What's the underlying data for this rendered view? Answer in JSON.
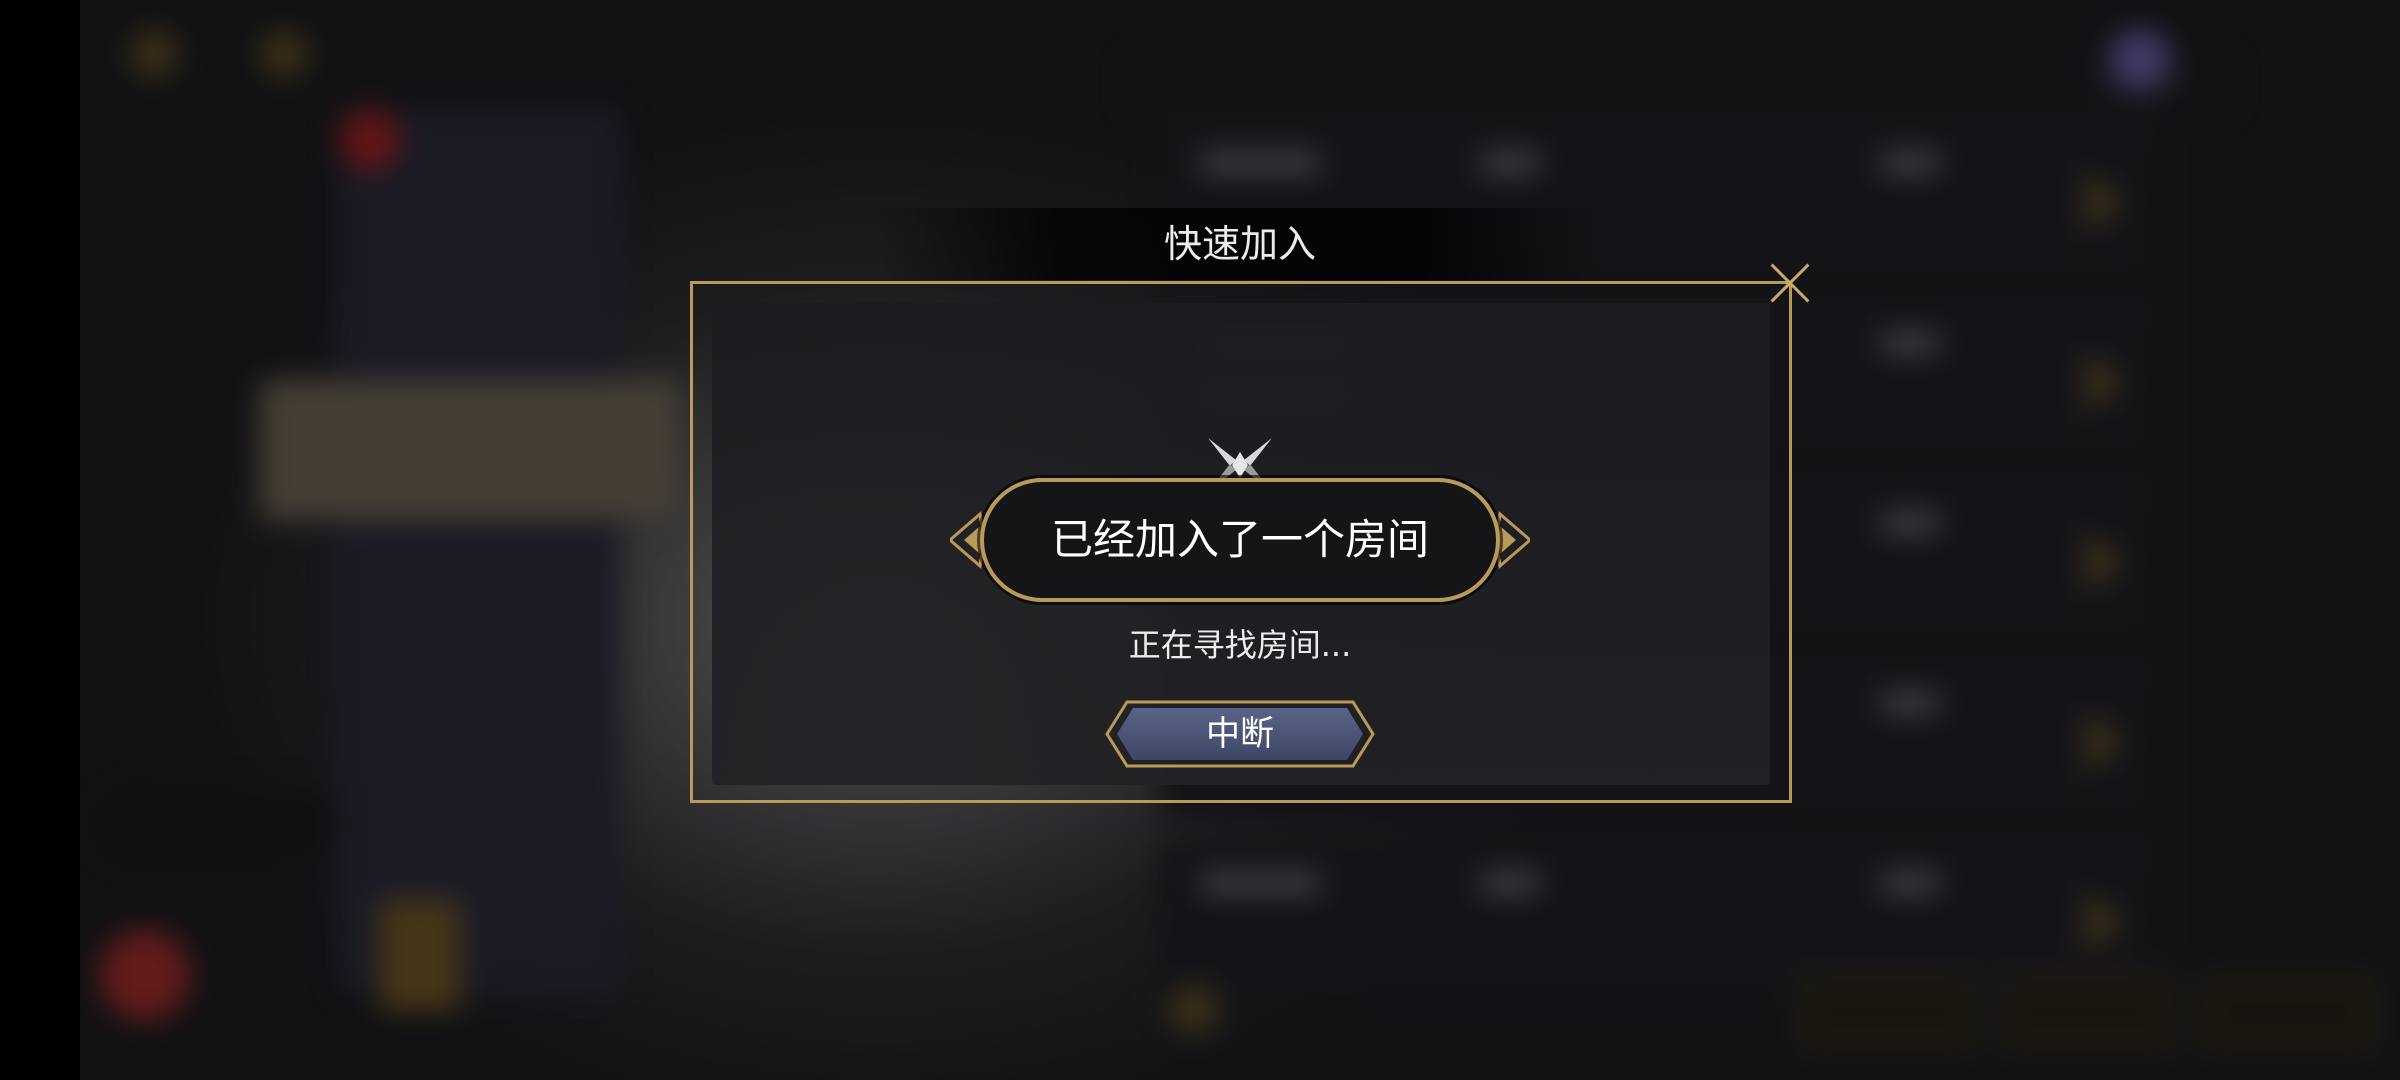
{
  "dialog": {
    "title": "快速加入",
    "status_message": "已经加入了一个房间",
    "progress_text": "正在寻找房间...",
    "interrupt_label": "中断"
  },
  "icons": {
    "close": "close-icon",
    "emblem": "crossed-blades-emblem-icon"
  },
  "colors": {
    "frame_gold": "#b89a5a",
    "button_blue": "#4a5478",
    "overlay_dark": "#1c1c20"
  }
}
